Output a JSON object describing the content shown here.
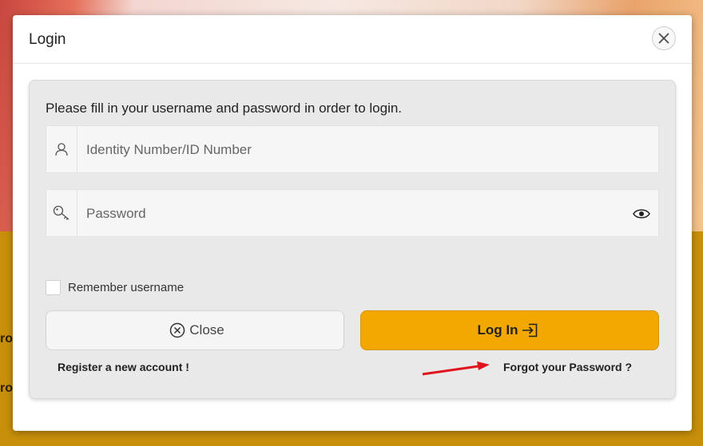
{
  "background": {
    "partial_lines": [
      "rov",
      "ro"
    ]
  },
  "modal": {
    "title": "Login",
    "instructions": "Please fill in your username and password in order to login.",
    "username": {
      "placeholder": "Identity Number/ID Number",
      "icon": "user-icon"
    },
    "password": {
      "placeholder": "Password",
      "icon": "key-icon",
      "toggle_icon": "eye-icon"
    },
    "remember": {
      "label": "Remember username",
      "checked": false
    },
    "buttons": {
      "close": {
        "label": "Close",
        "icon": "circle-x-icon"
      },
      "login": {
        "label": "Log In",
        "icon": "sign-in-icon"
      }
    },
    "links": {
      "register": "Register a new account !",
      "forgot": "Forgot your Password ?"
    },
    "annotation": {
      "type": "red-arrow",
      "points_to": "forgot-password-link"
    }
  },
  "colors": {
    "accent": "#f2a800",
    "background_band": "#c8900a",
    "panel": "#e9e9e9",
    "annotation_arrow": "#e0141e"
  }
}
